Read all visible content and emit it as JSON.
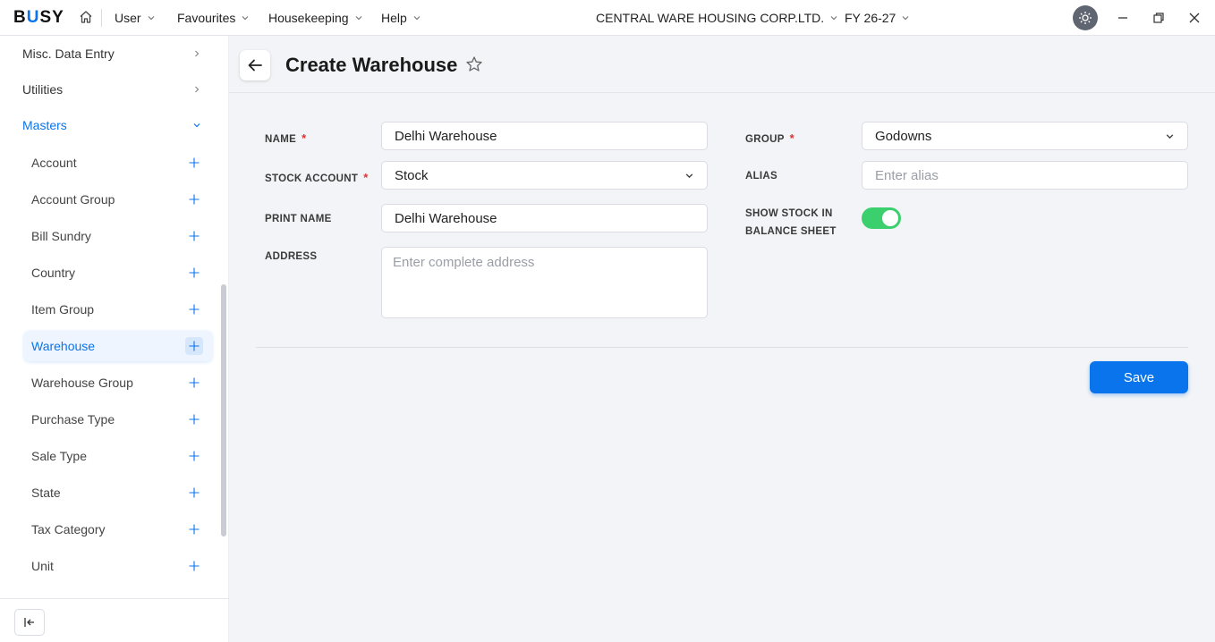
{
  "topbar": {
    "logo_prefix": "B",
    "logo_accent": "U",
    "logo_suffix": "SY",
    "menus": [
      "User",
      "Favourites",
      "Housekeeping",
      "Help"
    ],
    "company": "CENTRAL WARE HOUSING CORP.LTD.",
    "fiscal_year": "FY 26-27",
    "icons": [
      "home-icon",
      "theme-icon",
      "minimize-icon",
      "restore-icon",
      "close-icon"
    ]
  },
  "sidebar": {
    "top_items": [
      {
        "label": "Misc. Data Entry",
        "icon": "chevron-right-icon"
      },
      {
        "label": "Utilities",
        "icon": "chevron-right-icon"
      },
      {
        "label": "Masters",
        "icon": "chevron-down-icon"
      }
    ],
    "sub_items": [
      "Account",
      "Account Group",
      "Bill Sundry",
      "Country",
      "Item Group",
      "Warehouse",
      "Warehouse Group",
      "Purchase Type",
      "Sale Type",
      "State",
      "Tax Category",
      "Unit"
    ],
    "selected": "Warehouse"
  },
  "page": {
    "title": "Create Warehouse"
  },
  "form": {
    "name_label": "NAME",
    "name_value": "Delhi Warehouse",
    "stock_account_label": "STOCK ACCOUNT",
    "stock_account_value": "Stock",
    "print_name_label": "PRINT NAME",
    "print_name_value": "Delhi Warehouse",
    "address_label": "ADDRESS",
    "address_placeholder": "Enter complete address",
    "group_label": "GROUP",
    "group_value": "Godowns",
    "alias_label": "ALIAS",
    "alias_placeholder": "Enter alias",
    "show_stock_label_line1": "SHOW STOCK IN",
    "show_stock_label_line2": "BALANCE SHEET",
    "show_stock_enabled": true,
    "required_marker": "*",
    "save_label": "Save"
  },
  "colors": {
    "accent": "#0a74ec",
    "toggle_on": "#3ccf6e",
    "required": "#d33333"
  }
}
